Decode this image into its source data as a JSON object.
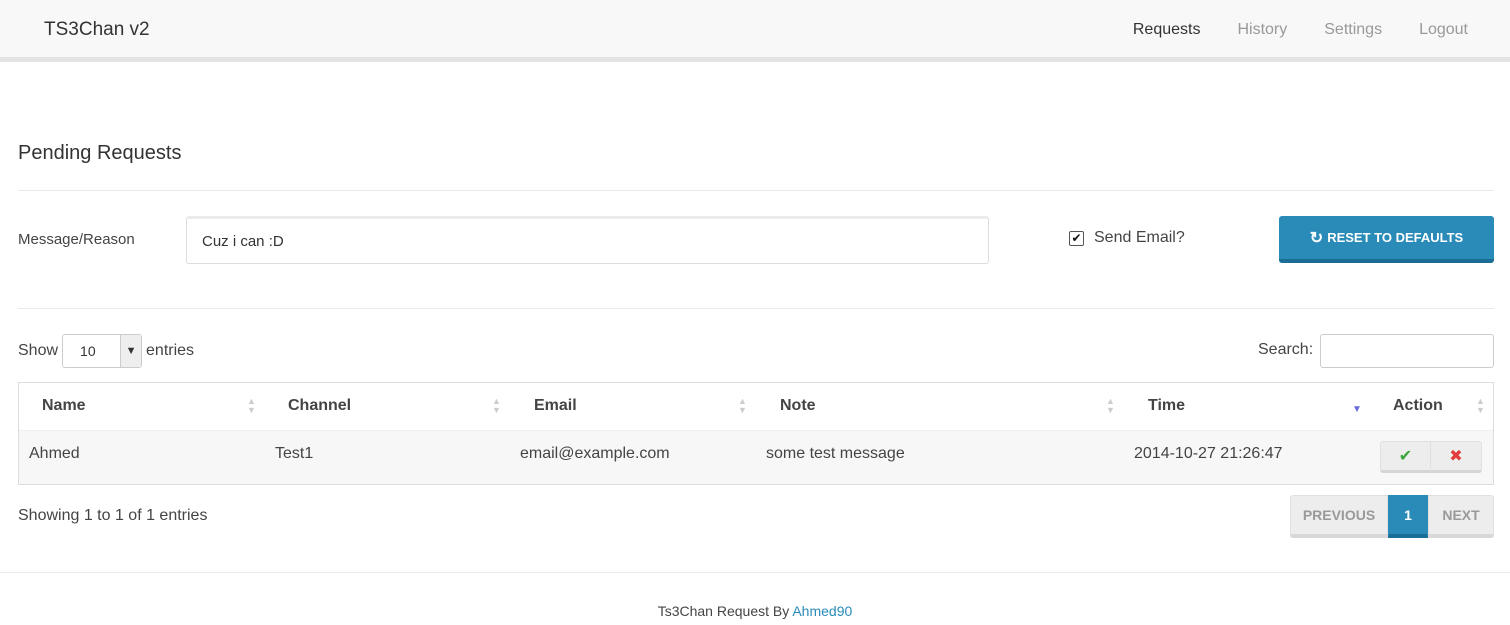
{
  "app": {
    "brand": "TS3Chan v2"
  },
  "nav": {
    "items": [
      {
        "label": "Requests",
        "active": true
      },
      {
        "label": "History",
        "active": false
      },
      {
        "label": "Settings",
        "active": false
      },
      {
        "label": "Logout",
        "active": false
      }
    ]
  },
  "page": {
    "title": "Pending Requests"
  },
  "form": {
    "message_label": "Message/Reason",
    "message_value": "Cuz i can :D",
    "send_email_label": "Send Email?",
    "send_email_checked": true,
    "reset_label": "RESET TO DEFAULTS",
    "reset_icon": "refresh-icon"
  },
  "table_controls": {
    "show_label": "Show",
    "entries_value": "10",
    "entries_label": "entries",
    "search_label": "Search:",
    "search_value": ""
  },
  "table": {
    "columns": [
      "Name",
      "Channel",
      "Email",
      "Note",
      "Time",
      "Action"
    ],
    "sorted_column": "Time",
    "sort_direction": "descending",
    "rows": [
      {
        "name": "Ahmed",
        "channel": "Test1",
        "email": "email@example.com",
        "note": "some test message",
        "time": "2014-10-27 21:26:47"
      }
    ],
    "action_icons": [
      "check-icon",
      "times-icon"
    ]
  },
  "info": {
    "text": "Showing 1 to 1 of 1 entries"
  },
  "pagination": {
    "previous": "PREVIOUS",
    "current": "1",
    "next": "NEXT"
  },
  "footer": {
    "text": "Ts3Chan Request By ",
    "link": "Ahmed90"
  },
  "colors": {
    "accent": "#2a8bb9",
    "ok": "#3aa63a",
    "danger": "#e23b3b"
  }
}
